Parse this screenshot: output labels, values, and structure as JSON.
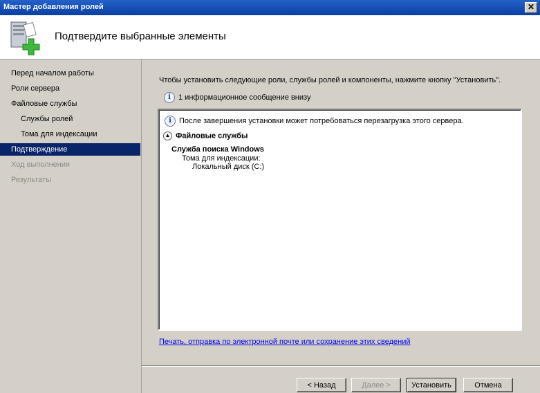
{
  "window": {
    "title": "Мастер добавления ролей",
    "close_glyph": "✕"
  },
  "header": {
    "title": "Подтвердите выбранные элементы",
    "icon": "server-add-icon"
  },
  "sidebar": {
    "items": [
      {
        "label": "Перед началом работы",
        "state": "normal",
        "level": "top"
      },
      {
        "label": "Роли сервера",
        "state": "normal",
        "level": "top"
      },
      {
        "label": "Файловые службы",
        "state": "normal",
        "level": "top"
      },
      {
        "label": "Службы ролей",
        "state": "normal",
        "level": "sub"
      },
      {
        "label": "Тома для индексации",
        "state": "normal",
        "level": "sub"
      },
      {
        "label": "Подтверждение",
        "state": "active",
        "level": "top"
      },
      {
        "label": "Ход выполнения",
        "state": "disabled",
        "level": "top"
      },
      {
        "label": "Результаты",
        "state": "disabled",
        "level": "top"
      }
    ]
  },
  "main": {
    "intro": "Чтобы установить следующие роли, службы ролей и компоненты, нажмите кнопку \"Установить\".",
    "info_count": "1 информационное сообщение внизу",
    "box": {
      "message": "После завершения установки может потребоваться перезагрузка этого сервера.",
      "section": "Файловые службы",
      "service": "Служба поиска Windows",
      "sub_label": "Тома для индексации:",
      "disk": "Локальный диск (C:)"
    },
    "link": "Печать, отправка по электронной почте или сохранение этих сведений"
  },
  "buttons": {
    "back": "< Назад",
    "next": "Далее >",
    "install": "Установить",
    "cancel": "Отмена"
  },
  "colors": {
    "active_bg": "#0a246a",
    "titlebar": "#0a3fa4",
    "link": "#0000ee"
  }
}
